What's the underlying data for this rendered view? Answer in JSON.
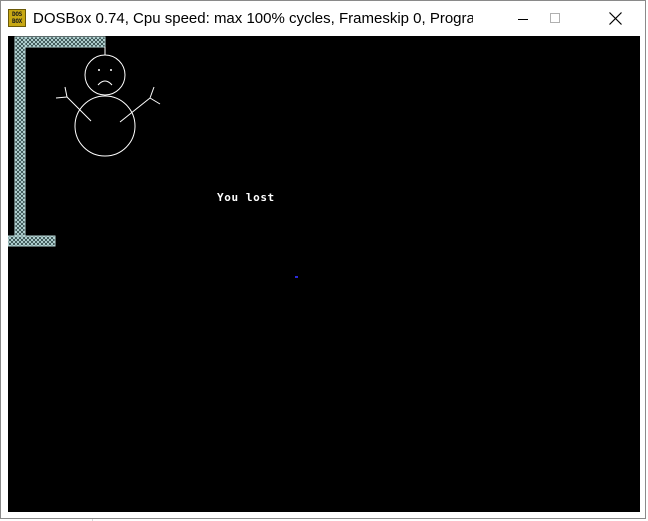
{
  "window": {
    "title": "DOSBox 0.74, Cpu speed: max 100% cycles, Frameskip  0, Progra...",
    "icon_label": "DOS BOX",
    "controls": {
      "minimize": "minimize-icon",
      "maximize": "maximize-icon",
      "close": "close-icon"
    }
  },
  "game": {
    "message": "You lost",
    "face": "sad",
    "colors": {
      "background": "#000000",
      "gallows": "#b8d8d8",
      "figure": "#ffffff",
      "text": "#ffffff"
    }
  }
}
